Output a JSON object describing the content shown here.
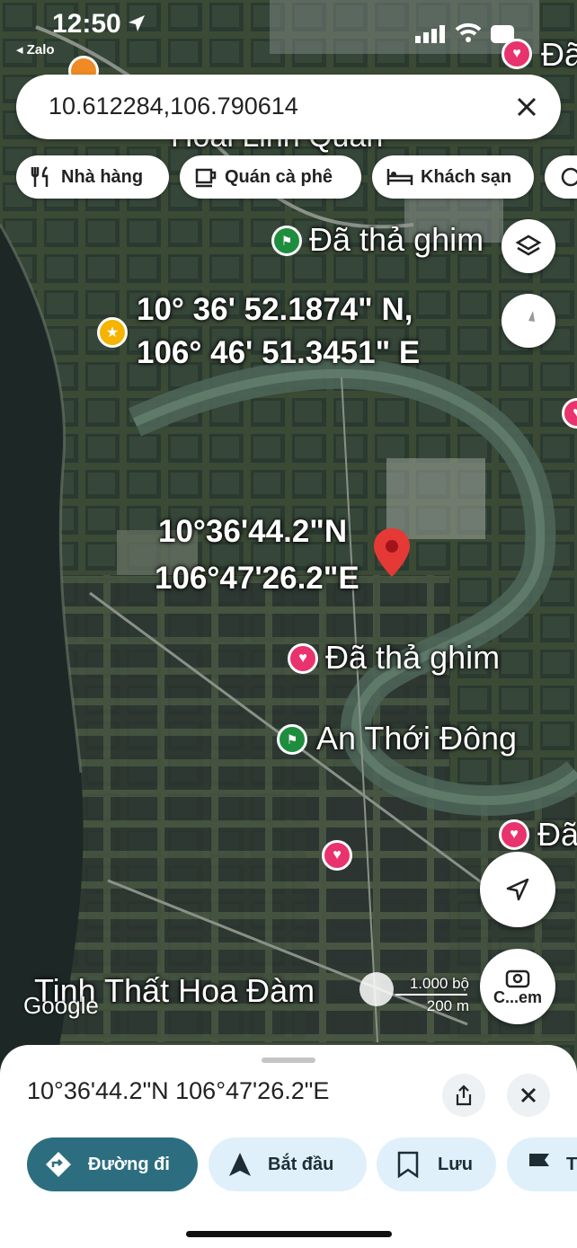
{
  "status_bar": {
    "time": "12:50",
    "back_app": "◂ Zalo"
  },
  "search": {
    "query": "10.612284,106.790614",
    "clear_icon": "close-icon"
  },
  "categories": [
    {
      "label": "Nhà hàng",
      "icon": "fork-knife-icon"
    },
    {
      "label": "Quán cà phê",
      "icon": "coffee-cup-icon"
    },
    {
      "label": "Khách sạn",
      "icon": "bed-icon"
    }
  ],
  "map": {
    "places": {
      "hoai_linh": "Hoai Linh Quan",
      "pinned_top": "Đã thả ghim",
      "pinned_mid": "Đã thả ghim",
      "an_thoi_dong": "An Thới Đông",
      "tinh_that": "Tinh Thất Hoa Đàm",
      "right_edge_1": "Đã",
      "right_edge_2": "Đã"
    },
    "coord_label_dms": {
      "line1": "10° 36' 52.1874\" N,",
      "line2": "106° 46' 51.3451\" E"
    },
    "coord_label_short": {
      "line1": "10°36'44.2\"N",
      "line2": "106°47'26.2\"E"
    },
    "attribution": "Google",
    "scale": {
      "top": "1.000 bộ",
      "bottom": "200 m"
    },
    "camera_label": "C...em",
    "colors": {
      "pin_red": "#e53935",
      "heart_pink": "#e8336e",
      "flag_green": "#1e8e3e",
      "star_yellow": "#f5b400"
    }
  },
  "sheet": {
    "title": "10°36'44.2\"N 106°47'26.2\"E",
    "actions": [
      {
        "label": "Đường đi",
        "icon": "directions-icon"
      },
      {
        "label": "Bắt đầu",
        "icon": "navigation-arrow-icon"
      },
      {
        "label": "Lưu",
        "icon": "bookmark-icon"
      },
      {
        "label": "T",
        "icon": "flag-icon"
      }
    ],
    "colors": {
      "primary": "#2c6e7f",
      "secondary": "#dff0fb"
    }
  }
}
